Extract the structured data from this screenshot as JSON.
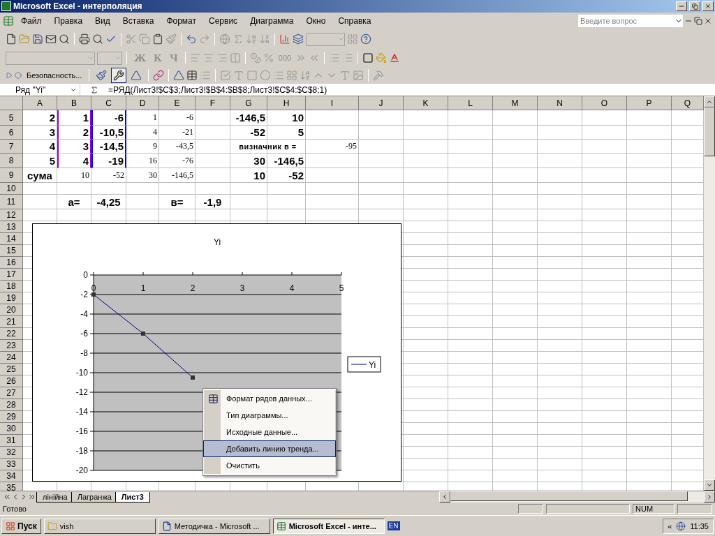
{
  "window": {
    "title": "Microsoft Excel - интерполяция"
  },
  "menu": [
    "Файл",
    "Правка",
    "Вид",
    "Вставка",
    "Формат",
    "Сервис",
    "Диаграмма",
    "Окно",
    "Справка"
  ],
  "help_search": {
    "placeholder": "Введите вопрос"
  },
  "format_toolbar": {
    "style_buttons": [
      {
        "label": "Ж",
        "disabled": true
      },
      {
        "label": "К",
        "disabled": true
      },
      {
        "label": "Ч",
        "disabled": true
      }
    ],
    "thousands": "000"
  },
  "chart_toolbar": {
    "security": "Безопасность...",
    "tools": [
      {
        "pressed": false
      },
      {
        "pressed": true
      },
      {
        "pressed": false
      }
    ]
  },
  "formula_bar": {
    "name_box": "Ряд \"Yi\"",
    "formula": "=РЯД(Лист3!$C$3;Лист3!$B$4:$B$8;Лист3!$C$4:$C$8;1)"
  },
  "sheet": {
    "columns": [
      "A",
      "B",
      "C",
      "D",
      "E",
      "F",
      "G",
      "H",
      "I",
      "J",
      "K",
      "L",
      "M",
      "N",
      "O",
      "P",
      "Q"
    ],
    "rows": [
      {
        "header": "5",
        "cells": {
          "a": {
            "text": "2",
            "kind": "large"
          },
          "b": {
            "text": "1",
            "kind": "large"
          },
          "c": {
            "text": "-6",
            "kind": "large"
          },
          "d": {
            "text": "1",
            "kind": "small"
          },
          "e": {
            "text": "-6",
            "kind": "small"
          },
          "g": {
            "text": "-146,5",
            "kind": "large"
          },
          "h": {
            "text": "10",
            "kind": "large"
          }
        }
      },
      {
        "header": "6",
        "cells": {
          "a": {
            "text": "3",
            "kind": "large"
          },
          "b": {
            "text": "2",
            "kind": "large"
          },
          "c": {
            "text": "-10,5",
            "kind": "large"
          },
          "d": {
            "text": "4",
            "kind": "small"
          },
          "e": {
            "text": "-21",
            "kind": "small"
          },
          "g": {
            "text": "-52",
            "kind": "large"
          },
          "h": {
            "text": "5",
            "kind": "large"
          }
        }
      },
      {
        "header": "7",
        "cells": {
          "a": {
            "text": "4",
            "kind": "large"
          },
          "b": {
            "text": "3",
            "kind": "large"
          },
          "c": {
            "text": "-14,5",
            "kind": "large"
          },
          "d": {
            "text": "9",
            "kind": "small"
          },
          "e": {
            "text": "-43,5",
            "kind": "small"
          },
          "g": {
            "text": "визначник в  =",
            "kind": "caption"
          },
          "i": {
            "text": "-95",
            "kind": "small"
          }
        }
      },
      {
        "header": "8",
        "cells": {
          "a": {
            "text": "5",
            "kind": "large"
          },
          "b": {
            "text": "4",
            "kind": "large"
          },
          "c": {
            "text": "-19",
            "kind": "large"
          },
          "d": {
            "text": "16",
            "kind": "small"
          },
          "e": {
            "text": "-76",
            "kind": "small"
          },
          "g": {
            "text": "30",
            "kind": "large"
          },
          "h": {
            "text": "-146,5",
            "kind": "large"
          }
        }
      },
      {
        "header": "9",
        "cells": {
          "a": {
            "text": "сума",
            "kind": "label"
          },
          "b": {
            "text": "10",
            "kind": "small"
          },
          "c": {
            "text": "-52",
            "kind": "small"
          },
          "d": {
            "text": "30",
            "kind": "small"
          },
          "e": {
            "text": "-146,5",
            "kind": "small"
          },
          "g": {
            "text": "10",
            "kind": "large"
          },
          "h": {
            "text": "-52",
            "kind": "large"
          }
        }
      },
      {
        "header": "10",
        "cells": {}
      },
      {
        "header": "11",
        "cells": {
          "b": {
            "text": "а=",
            "kind": "center"
          },
          "c": {
            "text": "-4,25",
            "kind": "center"
          },
          "e": {
            "text": "в=",
            "kind": "center"
          },
          "f": {
            "text": "-1,9",
            "kind": "center"
          }
        }
      },
      {
        "header": "12",
        "cells": {}
      },
      {
        "header": "13",
        "cells": {}
      },
      {
        "header": "14",
        "cells": {}
      },
      {
        "header": "15",
        "cells": {}
      },
      {
        "header": "16",
        "cells": {}
      },
      {
        "header": "17",
        "cells": {}
      },
      {
        "header": "18",
        "cells": {}
      },
      {
        "header": "19",
        "cells": {}
      },
      {
        "header": "20",
        "cells": {}
      },
      {
        "header": "21",
        "cells": {}
      },
      {
        "header": "22",
        "cells": {}
      },
      {
        "header": "23",
        "cells": {}
      },
      {
        "header": "24",
        "cells": {}
      },
      {
        "header": "25",
        "cells": {}
      },
      {
        "header": "26",
        "cells": {}
      },
      {
        "header": "27",
        "cells": {}
      },
      {
        "header": "28",
        "cells": {}
      },
      {
        "header": "29",
        "cells": {}
      },
      {
        "header": "30",
        "cells": {}
      },
      {
        "header": "31",
        "cells": {}
      },
      {
        "header": "32",
        "cells": {}
      },
      {
        "header": "33",
        "cells": {}
      },
      {
        "header": "34",
        "cells": {}
      },
      {
        "header": "35",
        "cells": {}
      }
    ]
  },
  "chart": {
    "chart_data": {
      "type": "line",
      "title": "Yi",
      "x": [
        0,
        1,
        2
      ],
      "series": [
        {
          "name": "Yi",
          "color": "#000080",
          "marker": true,
          "values": [
            -2,
            -6,
            -10.5
          ]
        }
      ],
      "grid": true,
      "xlim": [
        0,
        5
      ],
      "ylim": [
        -20,
        0
      ],
      "xticks": [
        0,
        1,
        2,
        3,
        4,
        5
      ],
      "yticks": [
        0,
        -2,
        -4,
        -6,
        -8,
        -10,
        -12,
        -14,
        -16,
        -18,
        -20
      ]
    }
  },
  "context_menu": {
    "items": [
      {
        "label": "Формат рядов данных...",
        "has_icon": true,
        "selected": false
      },
      {
        "label": "Тип диаграммы...",
        "has_icon": false,
        "selected": false
      },
      {
        "label": "Исходные данные...",
        "has_icon": false,
        "selected": false
      },
      {
        "label": "Добавить линию тренда...",
        "has_icon": false,
        "selected": true
      },
      {
        "label": "Очистить",
        "has_icon": false,
        "selected": false
      }
    ]
  },
  "sheet_tabs": [
    {
      "label": "лінійна",
      "selected": false
    },
    {
      "label": "Лагранжа",
      "selected": false
    },
    {
      "label": "Лист3",
      "selected": true
    }
  ],
  "status_bar": {
    "text": "Готово",
    "indicator": "NUM"
  },
  "taskbar": {
    "start": "Пуск",
    "tasks": [
      {
        "label": "vish",
        "kind": "folder",
        "selected": false
      },
      {
        "label": "Методичка - Microsoft ...",
        "kind": "word",
        "selected": false
      },
      {
        "label": "Microsoft Excel - инте...",
        "kind": "excel",
        "selected": true
      }
    ],
    "language": "EN",
    "tray_toggle": "«",
    "clock": "11:35"
  }
}
